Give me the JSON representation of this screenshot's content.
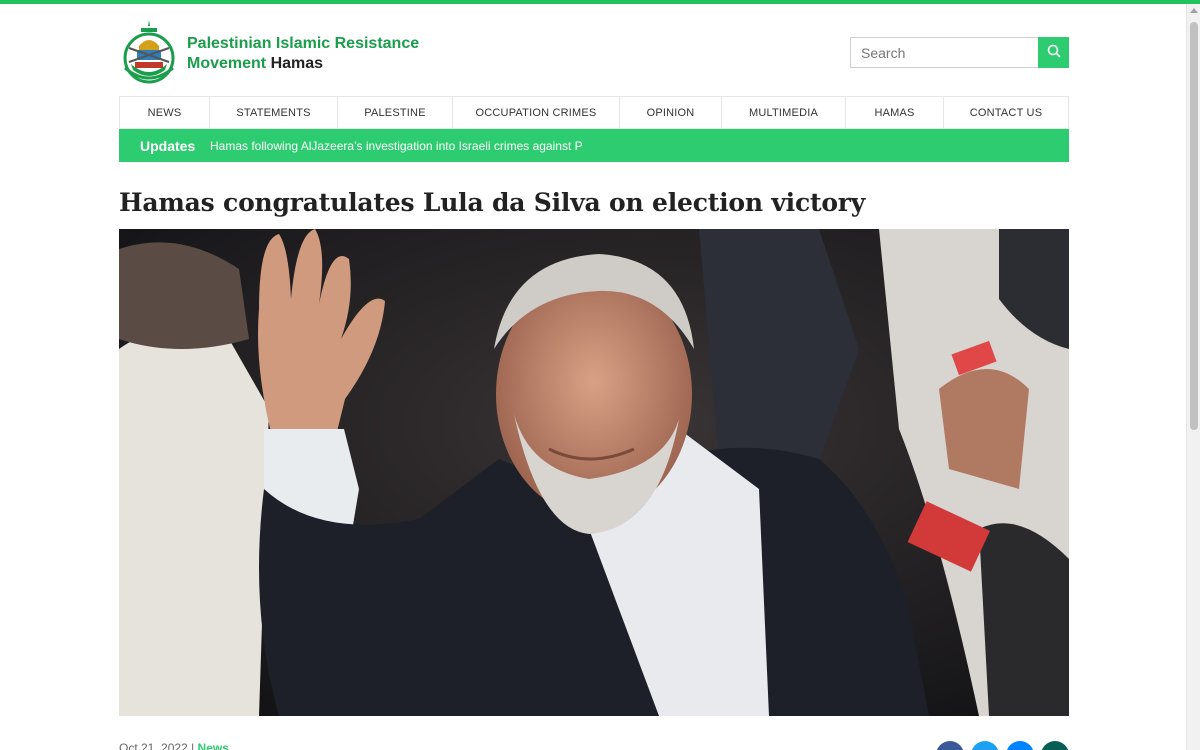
{
  "site": {
    "name_line1": "Palestinian Islamic Resistance",
    "name_line2_prefix": "Movement ",
    "name_line2_accent": "Hamas"
  },
  "search": {
    "placeholder": "Search",
    "value": ""
  },
  "nav": {
    "items": [
      {
        "label": "NEWS"
      },
      {
        "label": "STATEMENTS"
      },
      {
        "label": "PALESTINE"
      },
      {
        "label": "OCCUPATION CRIMES"
      },
      {
        "label": "OPINION"
      },
      {
        "label": "MULTIMEDIA"
      },
      {
        "label": "HAMAS"
      },
      {
        "label": "CONTACT US"
      }
    ]
  },
  "updates": {
    "label": "Updates",
    "ticker": "Hamas following AlJazeera’s investigation into Israeli crimes against P"
  },
  "article": {
    "title": "Hamas congratulates Lula da Silva on election victory",
    "date": "Oct 21, 2022",
    "separator": "|",
    "category": "News"
  },
  "colors": {
    "brand_green": "#2ecc71",
    "brand_dark_green": "#1a9e4b",
    "facebook": "#3b5998",
    "twitter": "#1da1f2",
    "messenger": "#0084ff",
    "whatsapp": "#075e54"
  },
  "icons": [
    "hamas-logo",
    "search-icon",
    "facebook-icon",
    "twitter-icon",
    "messenger-icon",
    "whatsapp-icon"
  ]
}
